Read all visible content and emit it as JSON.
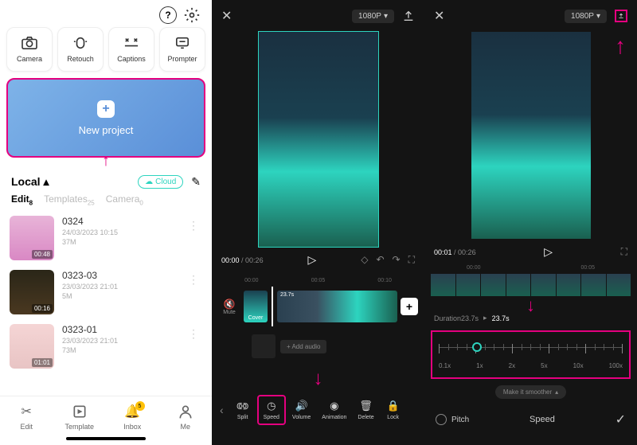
{
  "panel1": {
    "tools": {
      "camera": "Camera",
      "retouch": "Retouch",
      "captions": "Captions",
      "prompter": "Prompter"
    },
    "new_project": "New project",
    "local": "Local",
    "cloud": "Cloud",
    "tabs": {
      "edit": "Edit",
      "edit_count": "8",
      "templates": "Templates",
      "templates_count": "25",
      "camera": "Camera",
      "camera_count": "0"
    },
    "projects": [
      {
        "name": "0324",
        "date": "24/03/2023 10:15",
        "size": "37M",
        "dur": "00:48"
      },
      {
        "name": "0323-03",
        "date": "23/03/2023 21:01",
        "size": "5M",
        "dur": "00:16"
      },
      {
        "name": "0323-01",
        "date": "23/03/2023 21:01",
        "size": "73M",
        "dur": "01:01"
      }
    ],
    "nav": {
      "edit": "Edit",
      "template": "Template",
      "inbox": "Inbox",
      "inbox_badge": "5",
      "me": "Me"
    }
  },
  "panel2": {
    "resolution": "1080P",
    "time_current": "00:00",
    "time_total": "00:26",
    "timeline": {
      "t1": "00:00",
      "t2": "00:05",
      "t3": "00:10",
      "mute": "Mute",
      "cover": "Cover",
      "clip_dur": "23.7s",
      "add_audio": "+ Add audio"
    },
    "tools": {
      "split": "Split",
      "speed": "Speed",
      "volume": "Volume",
      "animation": "Animation",
      "delete": "Delete",
      "lock": "Lock"
    }
  },
  "panel3": {
    "resolution": "1080P",
    "time_current": "00:01",
    "time_total": "00:26",
    "duration_label": "Duration23.7s",
    "duration_arrow": "▸",
    "duration_val": "23.7s",
    "speed_marks": {
      "m1": "0.1x",
      "m2": "1x",
      "m3": "2x",
      "m4": "5x",
      "m5": "10x",
      "m6": "100x"
    },
    "smoother": "Make it smoother",
    "pitch": "Pitch",
    "speed_title": "Speed",
    "tl": {
      "t1": "00:00",
      "t2": "00:05"
    }
  }
}
